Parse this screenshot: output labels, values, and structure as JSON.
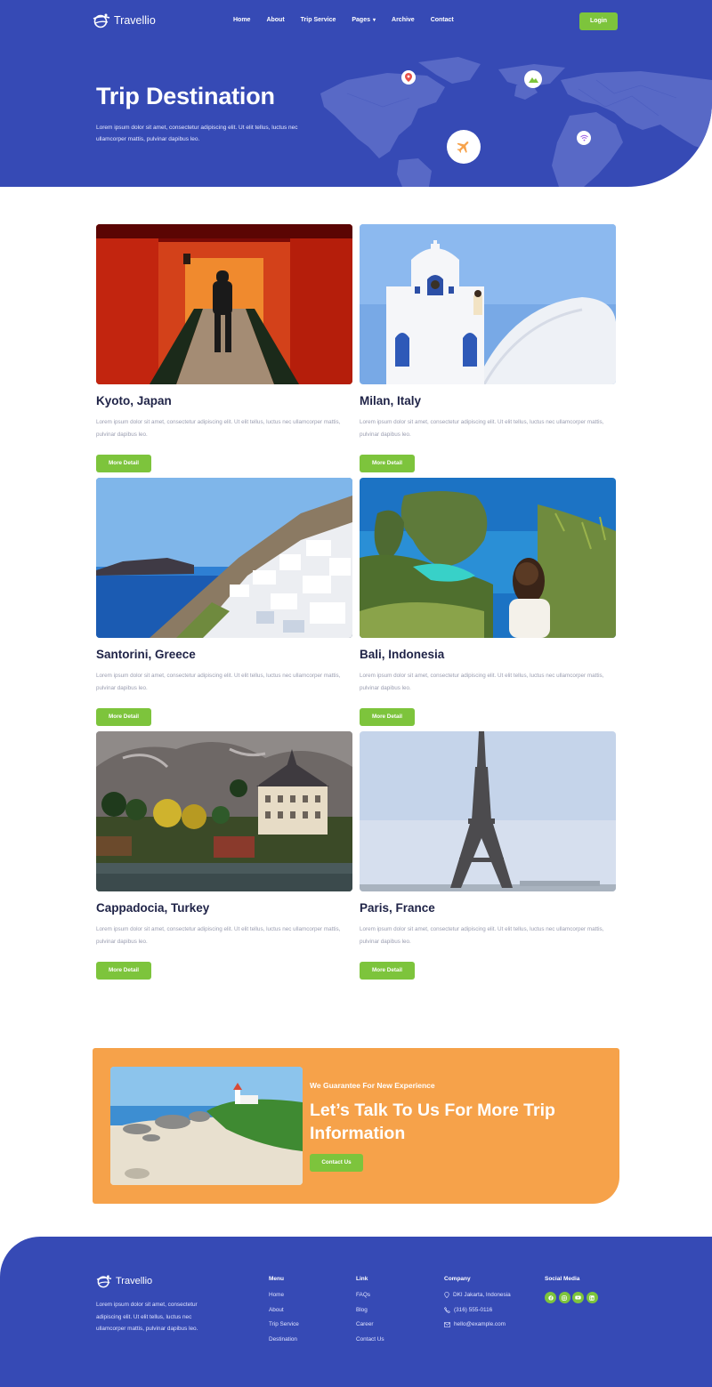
{
  "brand": {
    "name": "Travellio"
  },
  "nav": {
    "items": [
      "Home",
      "About",
      "Trip Service",
      "Pages",
      "Archive",
      "Contact"
    ],
    "login": "Login"
  },
  "hero": {
    "title": "Trip Destination",
    "description": "Lorem ipsum dolor sit amet, consectetur adipiscing elit. Ut elit tellus, luctus nec ullamcorper mattis, pulvinar dapibus leo."
  },
  "destinations": [
    {
      "name": "Kyoto, Japan",
      "description": "Lorem ipsum dolor sit amet, consectetur adipiscing elit. Ut elit tellus, luctus nec ullamcorper mattis, pulvinar dapibus leo.",
      "button": "More Detail"
    },
    {
      "name": "Milan, Italy",
      "description": "Lorem ipsum dolor sit amet, consectetur adipiscing elit. Ut elit tellus, luctus nec ullamcorper mattis, pulvinar dapibus leo.",
      "button": "More Detail"
    },
    {
      "name": "Santorini, Greece",
      "description": "Lorem ipsum dolor sit amet, consectetur adipiscing elit. Ut elit tellus, luctus nec ullamcorper mattis, pulvinar dapibus leo.",
      "button": "More Detail"
    },
    {
      "name": "Bali, Indonesia",
      "description": "Lorem ipsum dolor sit amet, consectetur adipiscing elit. Ut elit tellus, luctus nec ullamcorper mattis, pulvinar dapibus leo.",
      "button": "More Detail"
    },
    {
      "name": "Cappadocia, Turkey",
      "description": "Lorem ipsum dolor sit amet, consectetur adipiscing elit. Ut elit tellus, luctus nec ullamcorper mattis, pulvinar dapibus leo.",
      "button": "More Detail"
    },
    {
      "name": "Paris, France",
      "description": "Lorem ipsum dolor sit amet, consectetur adipiscing elit. Ut elit tellus, luctus nec ullamcorper mattis, pulvinar dapibus leo.",
      "button": "More Detail"
    }
  ],
  "cta": {
    "subtitle": "We Guarantee For New Experience",
    "title": "Let’s Talk To Us For More Trip Information",
    "button": "Contact Us"
  },
  "footer": {
    "description": "Lorem ipsum dolor sit amet, consectetur adipiscing elit. Ut elit tellus, luctus nec ullamcorper mattis, pulvinar dapibus leo.",
    "menu": {
      "heading": "Menu",
      "links": [
        "Home",
        "About",
        "Trip Service",
        "Destination"
      ]
    },
    "link": {
      "heading": "Link",
      "links": [
        "FAQs",
        "Blog",
        "Career",
        "Contact Us"
      ]
    },
    "company": {
      "heading": "Company",
      "address": "DKI Jakarta, Indonesia",
      "phone": "(316) 555-0116",
      "email": "hello@example.com"
    },
    "social": {
      "heading": "Social Media",
      "icons": [
        "facebook-icon",
        "instagram-icon",
        "youtube-icon",
        "linkedin-icon"
      ]
    }
  },
  "colors": {
    "primary": "#364ab5",
    "accent": "#7dc43c",
    "cta": "#f6a24a"
  }
}
